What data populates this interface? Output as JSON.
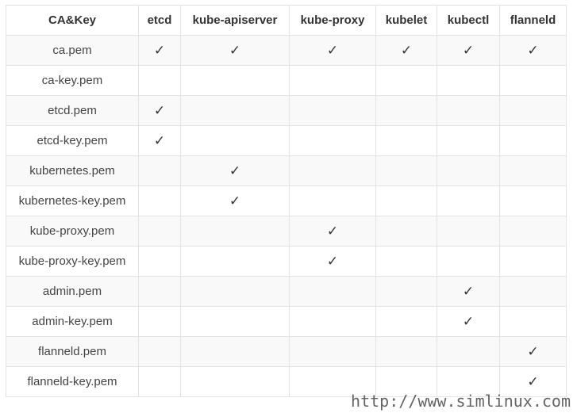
{
  "table": {
    "corner_header": "CA&Key",
    "check_glyph": "✓",
    "columns": [
      "etcd",
      "kube-apiserver",
      "kube-proxy",
      "kubelet",
      "kubectl",
      "flanneld"
    ],
    "rows": [
      {
        "label": "ca.pem",
        "checks": [
          true,
          true,
          true,
          true,
          true,
          true
        ]
      },
      {
        "label": "ca-key.pem",
        "checks": [
          false,
          false,
          false,
          false,
          false,
          false
        ]
      },
      {
        "label": "etcd.pem",
        "checks": [
          true,
          false,
          false,
          false,
          false,
          false
        ]
      },
      {
        "label": "etcd-key.pem",
        "checks": [
          true,
          false,
          false,
          false,
          false,
          false
        ]
      },
      {
        "label": "kubernetes.pem",
        "checks": [
          false,
          true,
          false,
          false,
          false,
          false
        ]
      },
      {
        "label": "kubernetes-key.pem",
        "checks": [
          false,
          true,
          false,
          false,
          false,
          false
        ]
      },
      {
        "label": "kube-proxy.pem",
        "checks": [
          false,
          false,
          true,
          false,
          false,
          false
        ]
      },
      {
        "label": "kube-proxy-key.pem",
        "checks": [
          false,
          false,
          true,
          false,
          false,
          false
        ]
      },
      {
        "label": "admin.pem",
        "checks": [
          false,
          false,
          false,
          false,
          true,
          false
        ]
      },
      {
        "label": "admin-key.pem",
        "checks": [
          false,
          false,
          false,
          false,
          true,
          false
        ]
      },
      {
        "label": "flanneld.pem",
        "checks": [
          false,
          false,
          false,
          false,
          false,
          true
        ]
      },
      {
        "label": "flanneld-key.pem",
        "checks": [
          false,
          false,
          false,
          false,
          false,
          true
        ]
      }
    ]
  },
  "watermark": "http://www.simlinux.com",
  "colors": {
    "border": "#e3e3e3",
    "stripe": "#f9f9f9",
    "text": "#333333"
  }
}
